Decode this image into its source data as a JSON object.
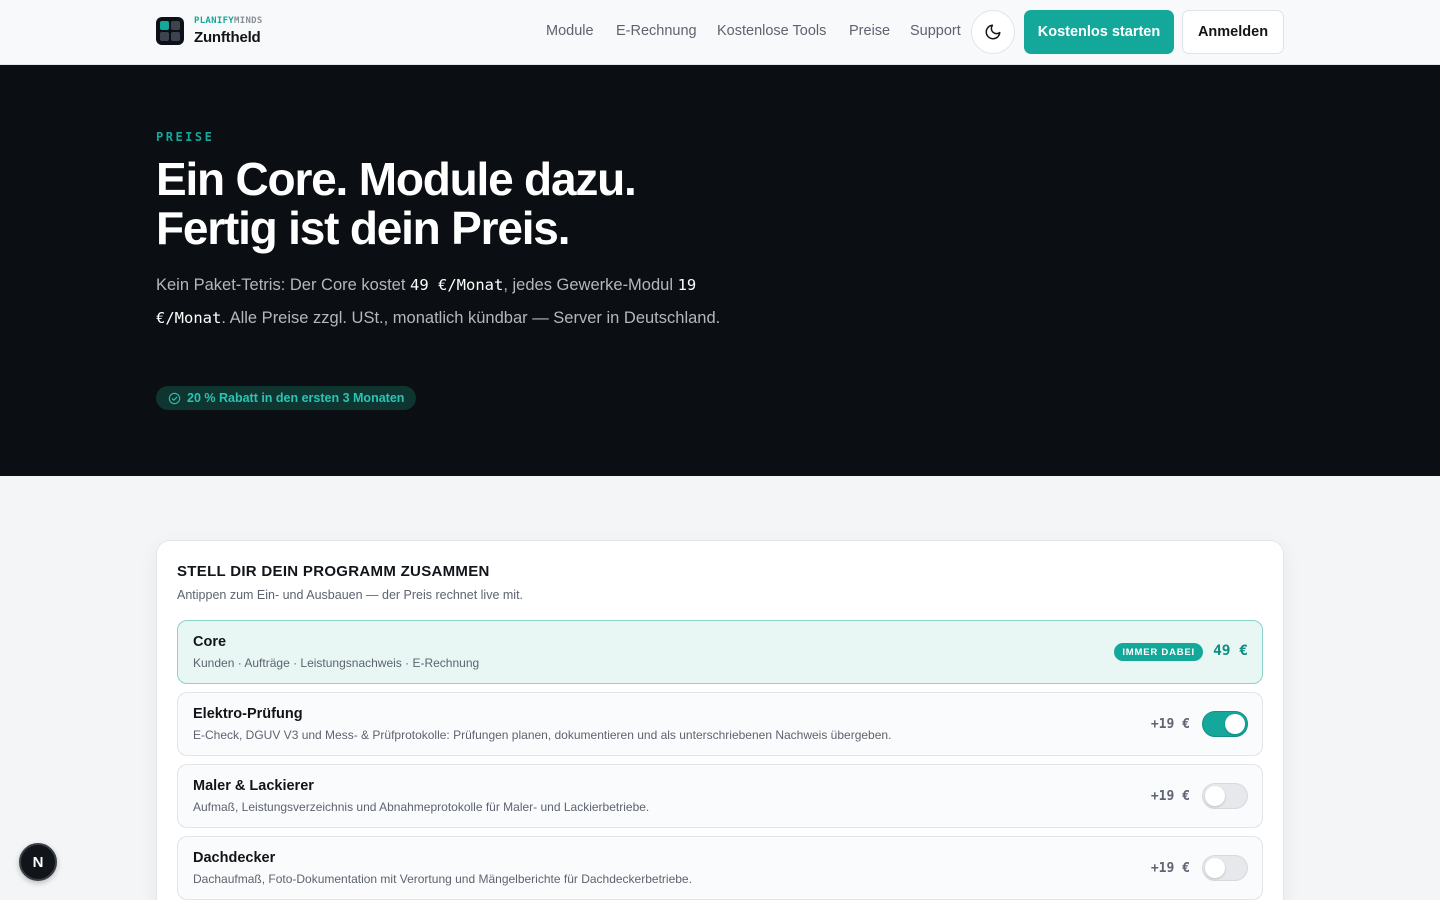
{
  "brand": {
    "part1": "PLANIFY",
    "part2": "MINDS",
    "name": "Zunftheld"
  },
  "nav": {
    "links": [
      "Module",
      "E-Rechnung",
      "Kostenlose Tools",
      "Preise",
      "Support"
    ],
    "theme_icon": "moon-icon",
    "cta": "Kostenlos starten",
    "login": "Anmelden"
  },
  "hero": {
    "eyebrow": "PREISE",
    "headline_line1": "Ein Core. Module dazu.",
    "headline_line2": "Fertig ist dein Preis.",
    "lead_part1": "Kein Paket-Tetris: Der Core kostet ",
    "lead_price1": "49 €/Monat",
    "lead_part2": ", jedes Gewerke-Modul ",
    "lead_price2": "19 €/Monat",
    "lead_part3": ". Alle Preise zzgl. USt., monatlich kündbar — Server in Deutschland.",
    "discount_icon": "check-circle-icon",
    "discount": "20 % Rabatt in den ersten 3 Monaten"
  },
  "configurator": {
    "title": "STELL DIR DEIN PROGRAMM ZUSAMMEN",
    "subtitle": "Antippen zum Ein- und Ausbauen — der Preis rechnet live mit.",
    "core": {
      "name": "Core",
      "description": "Kunden · Aufträge · Leistungsnachweis · E-Rechnung",
      "badge": "IMMER DABEI",
      "price": "49 €"
    },
    "modules": [
      {
        "name": "Elektro-Prüfung",
        "description": "E-Check, DGUV V3 und Mess- & Prüfprotokolle: Prüfungen planen, dokumentieren und als unterschriebenen Nachweis übergeben.",
        "price": "+19 €",
        "enabled": true
      },
      {
        "name": "Maler & Lackierer",
        "description": "Aufmaß, Leistungsverzeichnis und Abnahmeprotokolle für Maler- und Lackierbetriebe.",
        "price": "+19 €",
        "enabled": false
      },
      {
        "name": "Dachdecker",
        "description": "Dachaufmaß, Foto-Dokumentation mit Verortung und Mängelberichte für Dachdeckerbetriebe.",
        "price": "+19 €",
        "enabled": false
      }
    ]
  },
  "dev_badge": "N"
}
